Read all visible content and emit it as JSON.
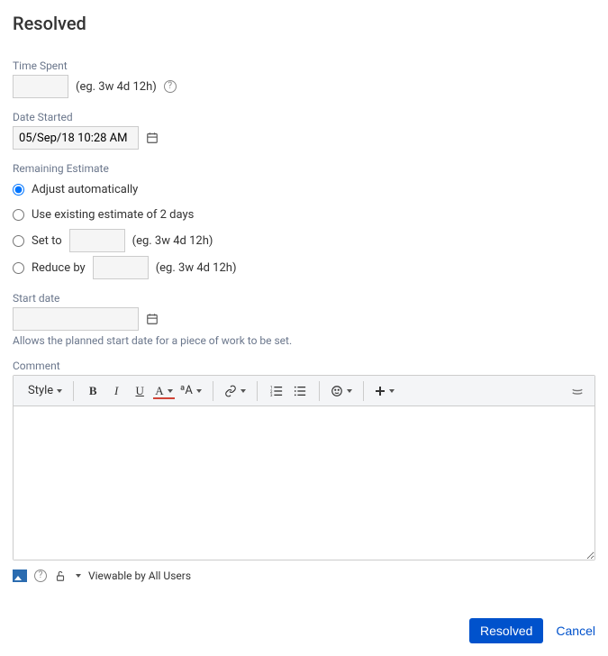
{
  "title": "Resolved",
  "time_spent": {
    "label": "Time Spent",
    "value": "",
    "hint": "(eg. 3w 4d 12h)"
  },
  "date_started": {
    "label": "Date Started",
    "value": "05/Sep/18 10:28 AM"
  },
  "remaining_estimate": {
    "label": "Remaining Estimate",
    "options": {
      "adjust": "Adjust automatically",
      "use_existing": "Use existing estimate of 2 days",
      "set_to": "Set to",
      "reduce_by": "Reduce by"
    },
    "set_to_value": "",
    "set_to_hint": "(eg. 3w 4d 12h)",
    "reduce_by_value": "",
    "reduce_by_hint": "(eg. 3w 4d 12h)",
    "selected": "adjust"
  },
  "start_date": {
    "label": "Start date",
    "value": "",
    "description": "Allows the planned start date for a piece of work to be set."
  },
  "comment": {
    "label": "Comment",
    "value": "",
    "toolbar": {
      "style": "Style",
      "supA": "ªA"
    },
    "visibility_text": "Viewable by All Users"
  },
  "actions": {
    "submit": "Resolved",
    "cancel": "Cancel"
  }
}
